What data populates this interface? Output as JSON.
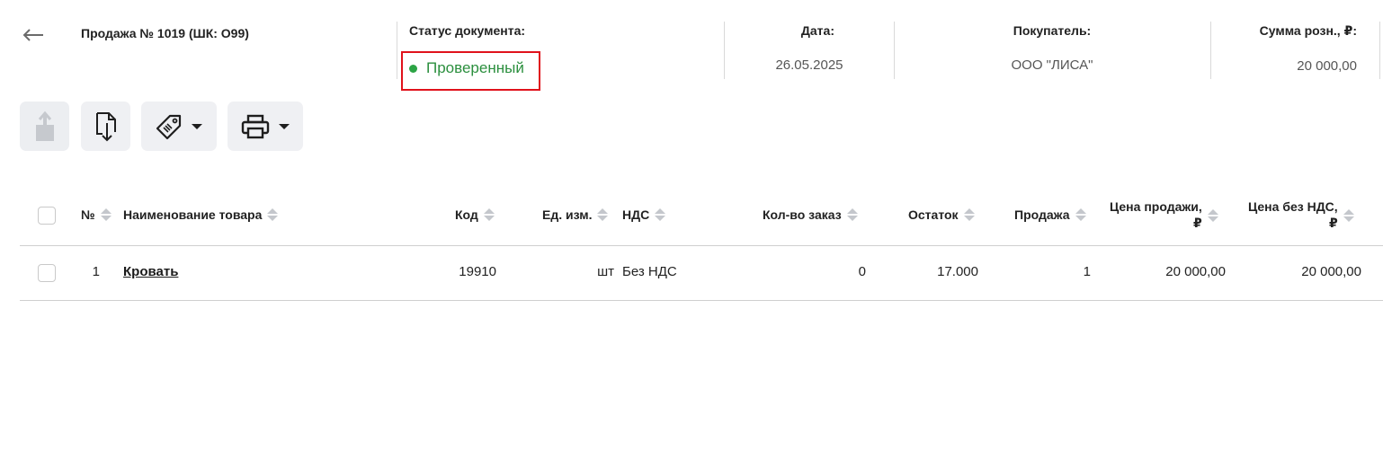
{
  "header": {
    "title": "Продажа № 1019 (ШК: О99)",
    "status_label": "Статус документа:",
    "status_value": "Проверенный",
    "status_color": "#2ca445",
    "date_label": "Дата:",
    "date_value": "26.05.2025",
    "buyer_label": "Покупатель:",
    "buyer_value": "ООО \"ЛИСА\"",
    "sum_label": "Сумма розн., ₽:",
    "sum_value": "20 000,00"
  },
  "toolbar": {
    "icons": [
      "export-icon",
      "document-download-icon",
      "price-tag-icon",
      "printer-icon"
    ]
  },
  "table": {
    "columns": {
      "num": "№",
      "name": "Наименование товара",
      "code": "Код",
      "unit": "Ед. изм.",
      "vat": "НДС",
      "qty_order": "Кол-во заказ",
      "stock": "Остаток",
      "sale": "Продажа",
      "price_line1": "Цена продажи,",
      "price_line2": "₽",
      "price_novat_line1": "Цена без НДС,",
      "price_novat_line2": "₽"
    },
    "rows": [
      {
        "num": "1",
        "name": "Кровать",
        "code": "19910",
        "unit": "шт",
        "vat": "Без НДС",
        "qty_order": "0",
        "stock": "17.000",
        "sale": "1",
        "price": "20 000,00",
        "price_novat": "20 000,00"
      }
    ]
  },
  "colors": {
    "accent_highlight": "#e0121b",
    "status_text": "#2b8f3e",
    "button_bg": "#eff0f3"
  }
}
